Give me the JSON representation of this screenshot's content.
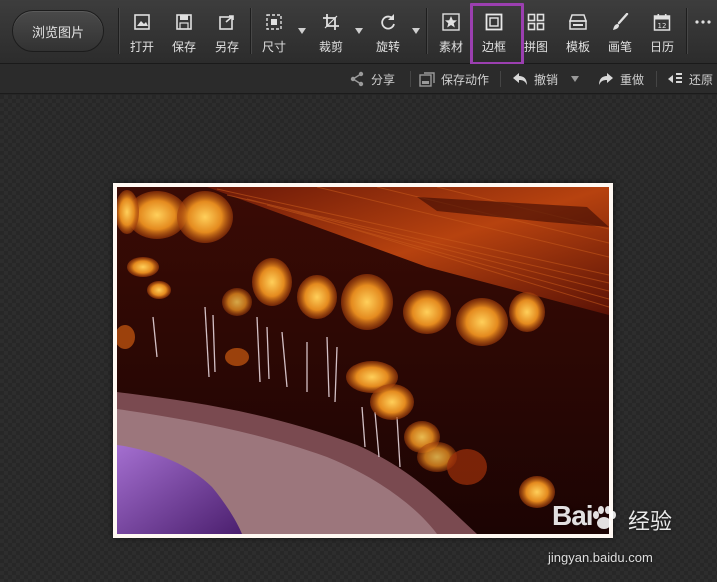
{
  "toolbar": {
    "browse_label": "浏览图片",
    "tools": [
      {
        "id": "open",
        "label": "打开",
        "icon": "image-open-icon"
      },
      {
        "id": "save",
        "label": "保存",
        "icon": "save-icon"
      },
      {
        "id": "saveas",
        "label": "另存",
        "icon": "save-as-icon"
      },
      {
        "id": "size",
        "label": "尺寸",
        "icon": "resize-icon"
      },
      {
        "id": "crop",
        "label": "裁剪",
        "icon": "crop-icon"
      },
      {
        "id": "rotate",
        "label": "旋转",
        "icon": "rotate-icon"
      },
      {
        "id": "material",
        "label": "素材",
        "icon": "star-icon"
      },
      {
        "id": "border",
        "label": "边框",
        "icon": "border-frame-icon",
        "active": true
      },
      {
        "id": "collage",
        "label": "拼图",
        "icon": "grid-icon"
      },
      {
        "id": "template",
        "label": "模板",
        "icon": "template-icon"
      },
      {
        "id": "brush",
        "label": "画笔",
        "icon": "brush-icon"
      },
      {
        "id": "calendar",
        "label": "日历",
        "icon": "calendar-icon",
        "calendar_day": "12"
      }
    ],
    "highlight_color": "#9b3fb0"
  },
  "actionbar": {
    "share": "分享",
    "save_action": "保存动作",
    "undo": "撤销",
    "redo": "重做",
    "restore": "还原"
  },
  "watermark": {
    "brand": "Bai",
    "brand_suffix": "经验",
    "url": "jingyan.baidu.com"
  }
}
